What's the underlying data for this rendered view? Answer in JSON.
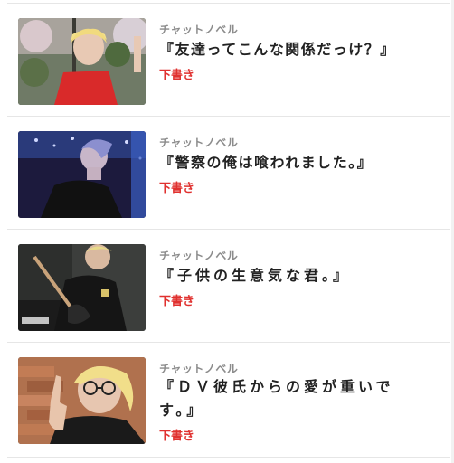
{
  "items": [
    {
      "category": "チャットノベル",
      "title": "『友達ってこんな関係だっけ？』",
      "status": "下書き",
      "thumbnail_icon": "photo-thumbnail"
    },
    {
      "category": "チャットノベル",
      "title": "『警察の俺は喰われました。』",
      "status": "下書き",
      "thumbnail_icon": "photo-thumbnail"
    },
    {
      "category": "チャットノベル",
      "title": "『子供の生意気な君。』",
      "status": "下書き",
      "thumbnail_icon": "photo-thumbnail"
    },
    {
      "category": "チャットノベル",
      "title_line1": "『ＤＶ彼氏からの愛が重いで",
      "title_line2": "す。』",
      "status": "下書き",
      "thumbnail_icon": "photo-thumbnail"
    }
  ],
  "colors": {
    "status": "#e0312f",
    "category": "#8c8c8c",
    "title": "#222222",
    "divider": "#e6e6e6"
  }
}
